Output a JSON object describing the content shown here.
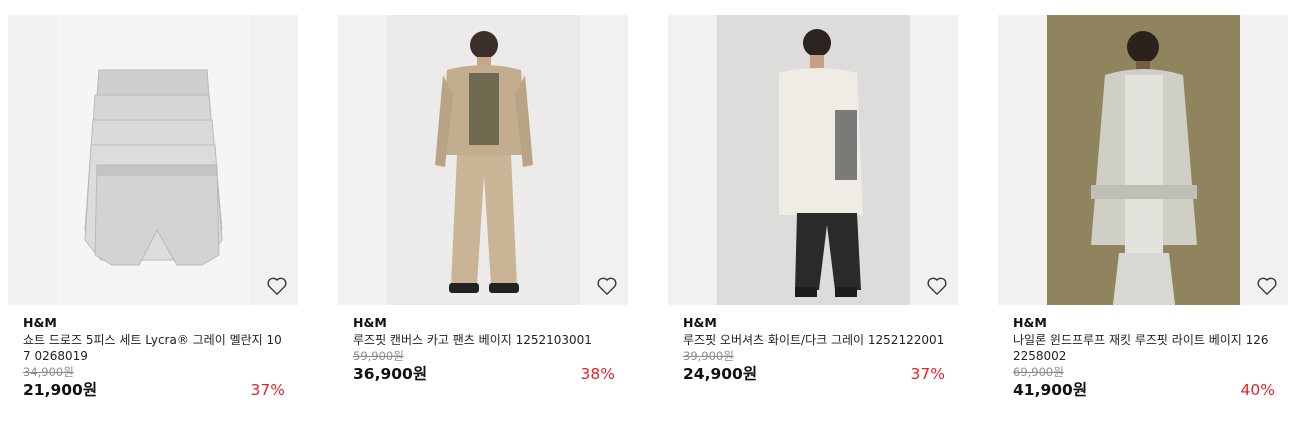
{
  "colors": {
    "discount": "#e4252b",
    "strike": "#8b8b8b",
    "text": "#111111"
  },
  "wishlist_icon": "heart-outline-icon",
  "products": [
    {
      "brand": "H&M",
      "title": "쇼트 드로즈 5피스 세트 Lycra® 그레이 멜란지 107 0268019",
      "original_price": "34,900원",
      "price": "21,900원",
      "discount": "37%"
    },
    {
      "brand": "H&M",
      "title": "루즈핏 캔버스 카고 팬츠 베이지 1252103001",
      "original_price": "59,900원",
      "price": "36,900원",
      "discount": "38%"
    },
    {
      "brand": "H&M",
      "title": "루즈핏 오버셔츠 화이트/다크 그레이 1252122001",
      "original_price": "39,900원",
      "price": "24,900원",
      "discount": "37%"
    },
    {
      "brand": "H&M",
      "title": "나일론 윈드프루프 재킷 루즈핏 라이트 베이지 126 2258002",
      "original_price": "69,900원",
      "price": "41,900원",
      "discount": "40%"
    }
  ]
}
